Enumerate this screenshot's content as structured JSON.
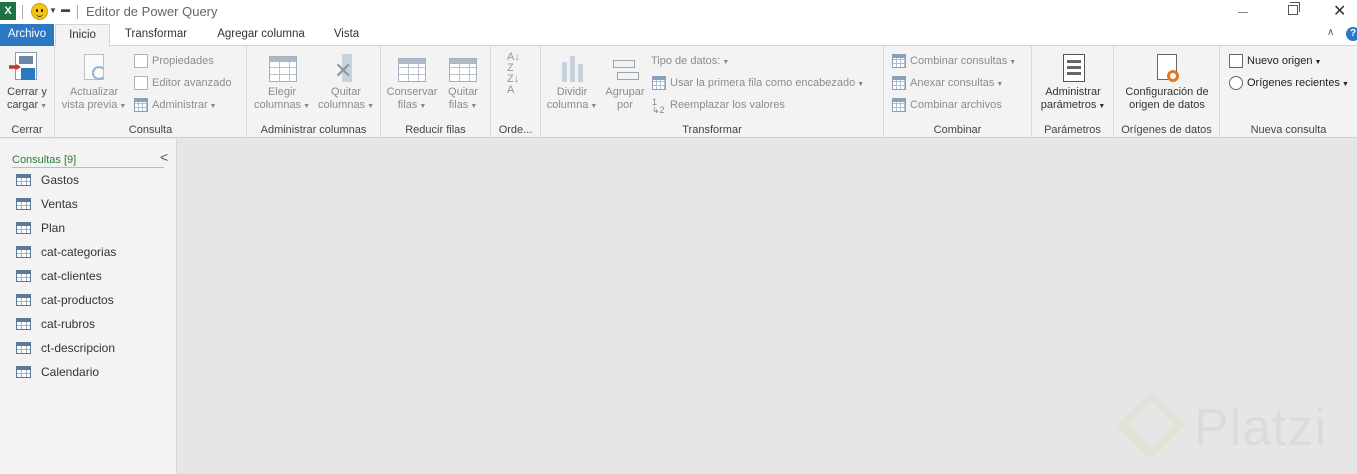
{
  "titlebar": {
    "app_icon": "X",
    "title": "Editor de Power Query",
    "icons": [
      "excel-icon",
      "smiley-icon",
      "minimize-icon",
      "restore-icon",
      "close-icon"
    ]
  },
  "tabs": {
    "file": "Archivo",
    "home": "Inicio",
    "transform": "Transformar",
    "add_column": "Agregar columna",
    "view": "Vista"
  },
  "ribbon": {
    "cerrar": {
      "btn_line1": "Cerrar y",
      "btn_line2": "cargar",
      "group": "Cerrar"
    },
    "consulta": {
      "refresh_line1": "Actualizar",
      "refresh_line2": "vista previa",
      "properties": "Propiedades",
      "advanced_editor": "Editor avanzado",
      "manage": "Administrar",
      "group": "Consulta"
    },
    "columnas": {
      "choose_line1": "Elegir",
      "choose_line2": "columnas",
      "remove_line1": "Quitar",
      "remove_line2": "columnas",
      "group": "Administrar columnas"
    },
    "filas": {
      "keep_line1": "Conservar",
      "keep_line2": "filas",
      "remove_line1": "Quitar",
      "remove_line2": "filas",
      "group": "Reducir filas"
    },
    "ordenar": {
      "group": "Orde..."
    },
    "transformar": {
      "split_line1": "Dividir",
      "split_line2": "columna",
      "group_by_line1": "Agrupar",
      "group_by_line2": "por",
      "data_type": "Tipo de datos:",
      "first_row_header": "Usar la primera fila como encabezado",
      "replace_values": "Reemplazar los valores",
      "group": "Transformar"
    },
    "combinar": {
      "merge": "Combinar consultas",
      "append": "Anexar consultas",
      "combine_files": "Combinar archivos",
      "group": "Combinar"
    },
    "parametros": {
      "btn_line1": "Administrar",
      "btn_line2": "parámetros",
      "group": "Parámetros"
    },
    "origenes": {
      "btn_line1": "Configuración de",
      "btn_line2": "origen de datos",
      "group": "Orígenes de datos"
    },
    "nueva": {
      "new_source": "Nuevo origen",
      "recent_sources": "Orígenes recientes",
      "group": "Nueva consulta"
    }
  },
  "queries_panel": {
    "title": "Consultas [9]",
    "items": [
      "Gastos",
      "Ventas",
      "Plan",
      "cat-categorias",
      "cat-clientes",
      "cat-productos",
      "cat-rubros",
      "ct-descripcion",
      "Calendario"
    ]
  },
  "watermark": {
    "text": "Platzi"
  },
  "colors": {
    "file_tab": "#2b78c5",
    "panel_title": "#2e7d32",
    "canvas": "#e6e6e6",
    "ribbon": "#f3f3f3"
  }
}
